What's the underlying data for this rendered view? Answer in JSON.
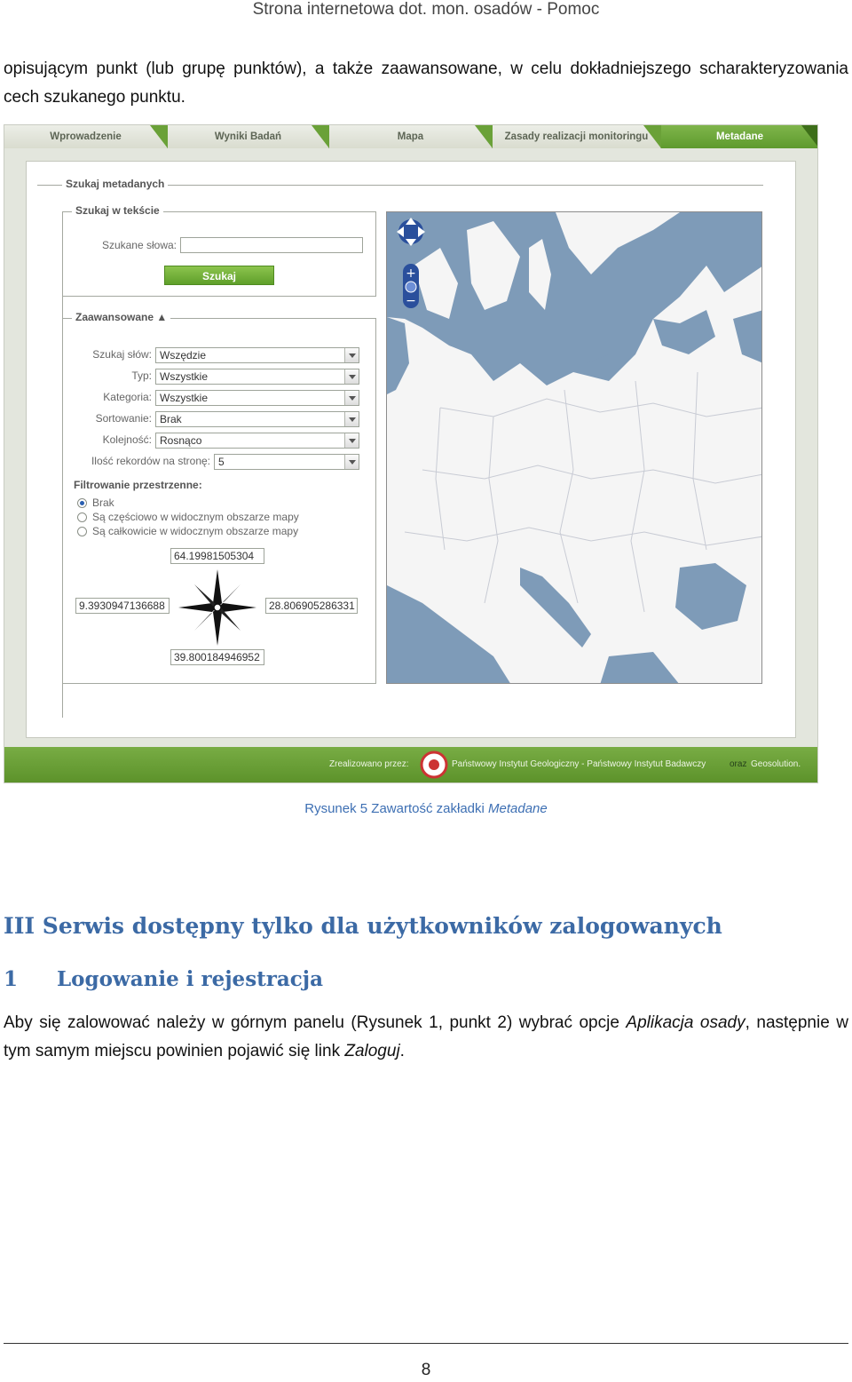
{
  "running_header": "Strona internetowa dot. mon. osadów - Pomoc",
  "intro_paragraph": "opisującym punkt (lub grupę punktów), a także zaawansowane, w celu dokładniejszego scharakteryzowania cech szukanego punktu.",
  "screenshot": {
    "tabs": [
      {
        "label": "Wprowadzenie",
        "active": false
      },
      {
        "label": "Wyniki Badań",
        "active": false
      },
      {
        "label": "Mapa",
        "active": false
      },
      {
        "label": "Zasady realizacji monitoringu",
        "active": false
      },
      {
        "label": "Metadane",
        "active": true
      }
    ],
    "search_metadata_legend": "Szukaj metadanych",
    "text_search": {
      "legend": "Szukaj w tekście",
      "words_label": "Szukane słowa:",
      "words_value": "",
      "search_button": "Szukaj"
    },
    "advanced": {
      "legend": "Zaawansowane ▲",
      "rows": [
        {
          "label": "Szukaj słów:",
          "value": "Wszędzie"
        },
        {
          "label": "Typ:",
          "value": "Wszystkie"
        },
        {
          "label": "Kategoria:",
          "value": "Wszystkie"
        },
        {
          "label": "Sortowanie:",
          "value": "Brak"
        },
        {
          "label": "Kolejność:",
          "value": "Rosnąco"
        },
        {
          "label": "Ilość rekordów na stronę:",
          "value": "5"
        }
      ],
      "spatial_filter_title": "Filtrowanie przestrzenne:",
      "spatial_options": [
        {
          "label": "Brak",
          "selected": true
        },
        {
          "label": "Są częściowo w widocznym obszarze mapy",
          "selected": false
        },
        {
          "label": "Są całkowicie w widocznym obszarze mapy",
          "selected": false
        }
      ],
      "bbox": {
        "north": "64.19981505304",
        "west": "9.3930947136688",
        "east": "28.806905286331",
        "south": "39.800184946952"
      }
    },
    "footer": {
      "prefix": "Zrealizowano przez:",
      "institute": "Państwowy Instytut Geologiczny - Państwowy Instytut Badawczy",
      "conj": "oraz",
      "partner": "Geosolution."
    },
    "colors": {
      "accent_green": "#6aa138",
      "sea_blue": "#7e9bb8",
      "land": "#f4f4f4"
    }
  },
  "caption": {
    "prefix": "Rysunek 5 Zawartość zakładki",
    "italic": "Metadane"
  },
  "heading_main": "III Serwis dostępny tylko dla użytkowników zalogowanych",
  "heading_sub": {
    "num": "1",
    "text": "Logowanie i rejestracja"
  },
  "body_paragraph": {
    "part1": "Aby się zalowować należy w górnym panelu (Rysunek 1, punkt 2) wybrać opcje ",
    "italic1": "Aplikacja osady",
    "part2": ", następnie w tym samym miejscu powinien pojawić się link ",
    "italic2": "Zaloguj",
    "part3": "."
  },
  "page_number": "8"
}
